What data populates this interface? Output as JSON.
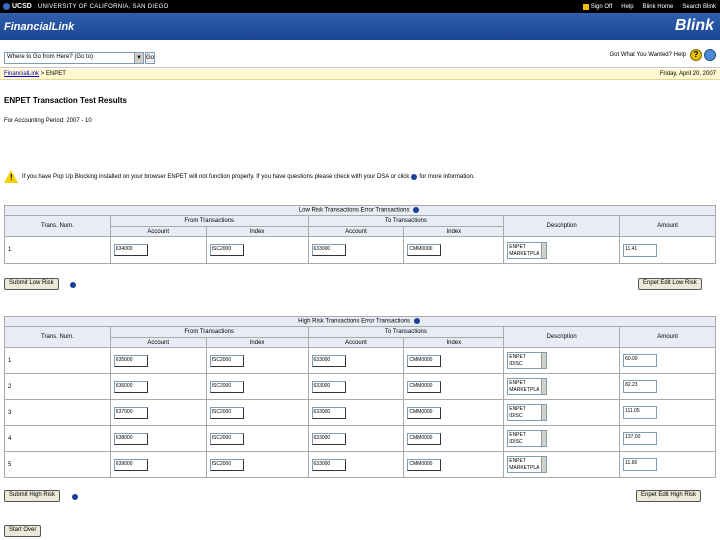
{
  "topbar": {
    "logo": "UCSD",
    "university": "UNIVERSITY OF CALIFORNIA, SAN DIEGO",
    "links": [
      "Sign Off",
      "Help",
      "Blink Home",
      "Search Blink"
    ]
  },
  "header": {
    "title": "FinancialLink",
    "blink": "Blink"
  },
  "toolbar": {
    "select_value": "Where to Go from Here? (Go to)",
    "go_label": "Go",
    "help_question": "Got What You Wanted? Help"
  },
  "breadcrumb": {
    "link": "FinancialLink",
    "current": "> ENPET",
    "date": "Friday, April 20, 2007"
  },
  "page": {
    "title": "ENPET Transaction Test Results",
    "period": "For Accounting Period: 2007 - 10"
  },
  "warning": {
    "text": "If you have Pop Up Blocking installed on your browser ENPET will not function properly. If you have questions please check with your DSA or click",
    "suffix": "for more information."
  },
  "low_risk": {
    "caption": "Low Risk Transactions Error Transactions",
    "headers": {
      "trans_num": "Trans. Num.",
      "from": "From Transactions",
      "to": "To Transactions",
      "account": "Account",
      "index": "Index",
      "description": "Description",
      "amount": "Amount"
    },
    "rows": [
      {
        "num": "1",
        "from_account": "634000",
        "from_index": "ISC2000",
        "to_account": "633000",
        "to_index": "CMM0000",
        "desc1": "ENPET",
        "desc2": "MARKETPLA",
        "amount": "11.41"
      }
    ],
    "submit": "Submit Low Risk",
    "edit": "Enpet Edit Low Risk"
  },
  "high_risk": {
    "caption": "High Risk Transactions Error Transactions",
    "rows": [
      {
        "num": "1",
        "from_account": "635000",
        "from_index": "ISC2000",
        "to_account": "633000",
        "to_index": "CMM0000",
        "desc1": "ENPET",
        "desc2": "IDISC",
        "amount": "60.00"
      },
      {
        "num": "2",
        "from_account": "636000",
        "from_index": "ISC2000",
        "to_account": "633000",
        "to_index": "CMM0000",
        "desc1": "ENPET",
        "desc2": "MARKETPLA",
        "amount": "82.23"
      },
      {
        "num": "3",
        "from_account": "637000",
        "from_index": "ISC2000",
        "to_account": "633000",
        "to_index": "CMM0000",
        "desc1": "ENPET",
        "desc2": "IDISC",
        "amount": "111.05"
      },
      {
        "num": "4",
        "from_account": "638000",
        "from_index": "ISC2000",
        "to_account": "633000",
        "to_index": "CMM0000",
        "desc1": "ENPET",
        "desc2": "IDISC",
        "amount": "137.00"
      },
      {
        "num": "5",
        "from_account": "639000",
        "from_index": "ISC2000",
        "to_account": "633000",
        "to_index": "CMM0000",
        "desc1": "ENPET",
        "desc2": "MARKETPLA",
        "amount": "11.66"
      }
    ],
    "submit": "Submit High Risk",
    "edit": "Enpet Edit High Risk"
  },
  "start_over": "Start Over"
}
